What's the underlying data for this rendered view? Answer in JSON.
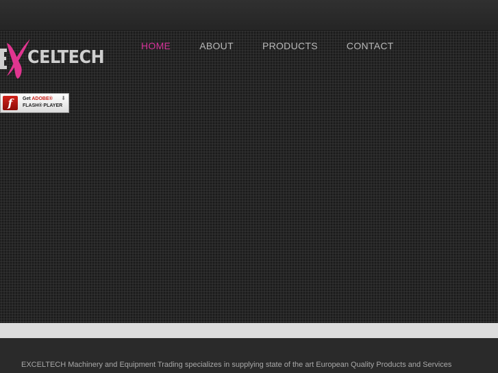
{
  "brand": {
    "logo_text": "CELTECH",
    "accent_color": "#d6339a"
  },
  "nav": {
    "items": [
      {
        "label": "HOME",
        "active": true
      },
      {
        "label": "ABOUT",
        "active": false
      },
      {
        "label": "PRODUCTS",
        "active": false
      },
      {
        "label": "CONTACT",
        "active": false
      }
    ]
  },
  "flash_badge": {
    "icon": "flash-player-icon",
    "get_label": "Get",
    "brand_label": "ADOBE®",
    "product_label": "FLASH® PLAYER"
  },
  "footer": {
    "intro": "EXCELTECH Machinery and Equipment Trading specializes in supplying state of the art European Quality Products and Services"
  }
}
